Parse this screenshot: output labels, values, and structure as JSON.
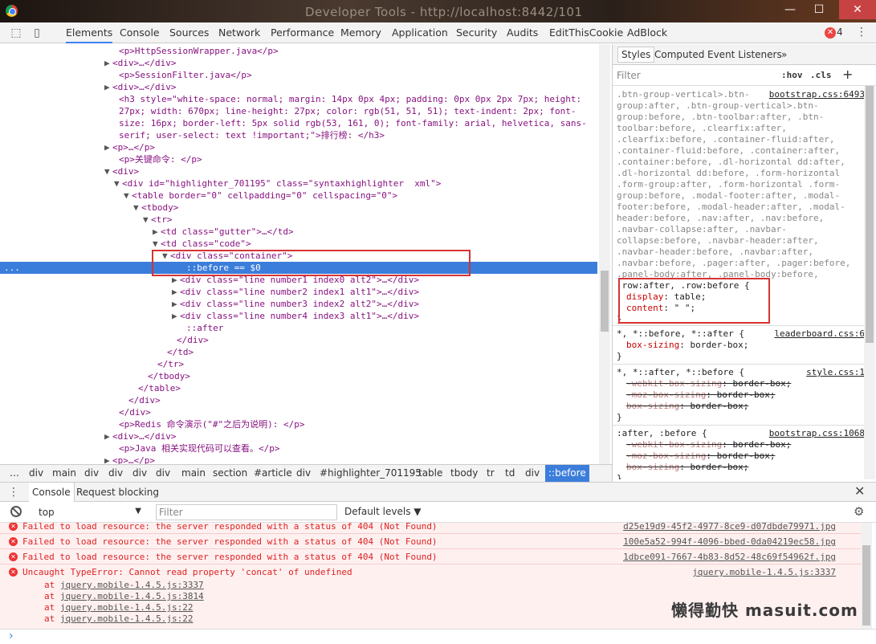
{
  "window": {
    "title": "Developer Tools - http://localhost:8442/101",
    "buttons": [
      "—",
      "☐",
      "✕"
    ]
  },
  "toolbar": {
    "tabs": [
      "Elements",
      "Console",
      "Sources",
      "Network",
      "Performance",
      "Memory",
      "Application",
      "Security",
      "Audits",
      "EditThisCookie",
      "AdBlock"
    ],
    "selected_tab": "Elements",
    "error_count": "4"
  },
  "dom_lines": [
    {
      "indent": 148,
      "tri": "",
      "html": "<p>HttpSessionWrapper.java</p>"
    },
    {
      "indent": 140,
      "tri": "▶",
      "html": "<div>…</div>"
    },
    {
      "indent": 148,
      "tri": "",
      "html": "<p>SessionFilter.java</p>"
    },
    {
      "indent": 140,
      "tri": "▶",
      "html": "<div>…</div>"
    },
    {
      "indent": 148,
      "tri": "",
      "html": "<h3 style=\"white-space: normal; margin: 14px 0px 4px; padding: 0px 0px 2px 7px; height:"
    },
    {
      "indent": 148,
      "tri": "",
      "html": "27px; width: 670px; line-height: 27px; color: rgb(51, 51, 51); text-indent: 2px; font-"
    },
    {
      "indent": 148,
      "tri": "",
      "html": "size: 16px; border-left: 5px solid rgb(53, 161, 0); font-family: arial, helvetica, sans-"
    },
    {
      "indent": 148,
      "tri": "",
      "html": "serif; user-select: text !important;\">排行榜: </h3>"
    },
    {
      "indent": 140,
      "tri": "▶",
      "html": "<p>…</p>"
    },
    {
      "indent": 148,
      "tri": "",
      "html": "<p>关键命令: </p>"
    },
    {
      "indent": 140,
      "tri": "▼",
      "html": "<div>"
    },
    {
      "indent": 152,
      "tri": "▼",
      "html": "<div id=\"highlighter_701195\" class=\"syntaxhighlighter  xml\">"
    },
    {
      "indent": 164,
      "tri": "▼",
      "html": "<table border=\"0\" cellpadding=\"0\" cellspacing=\"0\">"
    },
    {
      "indent": 176,
      "tri": "▼",
      "html": "<tbody>"
    },
    {
      "indent": 188,
      "tri": "▼",
      "html": "<tr>"
    },
    {
      "indent": 200,
      "tri": "▶",
      "html": "<td class=\"gutter\">…</td>"
    },
    {
      "indent": 200,
      "tri": "▼",
      "html": "<td class=\"code\">"
    },
    {
      "indent": 212,
      "tri": "▼",
      "html": "<div class=\"container\">"
    },
    {
      "indent": 232,
      "tri": "",
      "html": "::before == $0",
      "selected": true
    },
    {
      "indent": 224,
      "tri": "▶",
      "html": "<div class=\"line number1 index0 alt2\">…</div>"
    },
    {
      "indent": 224,
      "tri": "▶",
      "html": "<div class=\"line number2 index1 alt1\">…</div>"
    },
    {
      "indent": 224,
      "tri": "▶",
      "html": "<div class=\"line number3 index2 alt2\">…</div>"
    },
    {
      "indent": 224,
      "tri": "▶",
      "html": "<div class=\"line number4 index3 alt1\">…</div>"
    },
    {
      "indent": 232,
      "tri": "",
      "html": "::after"
    },
    {
      "indent": 220,
      "tri": "",
      "html": "</div>"
    },
    {
      "indent": 208,
      "tri": "",
      "html": "</td>"
    },
    {
      "indent": 196,
      "tri": "",
      "html": "</tr>"
    },
    {
      "indent": 184,
      "tri": "",
      "html": "</tbody>"
    },
    {
      "indent": 172,
      "tri": "",
      "html": "</table>"
    },
    {
      "indent": 160,
      "tri": "",
      "html": "</div>"
    },
    {
      "indent": 148,
      "tri": "",
      "html": "</div>"
    },
    {
      "indent": 148,
      "tri": "",
      "html": "<p>Redis 命令演示(\"#\"之后为说明): </p>"
    },
    {
      "indent": 140,
      "tri": "▶",
      "html": "<div>…</div>"
    },
    {
      "indent": 148,
      "tri": "",
      "html": "<p>Java 相关实现代码可以查看。</p>"
    },
    {
      "indent": 140,
      "tri": "▶",
      "html": "<p>…</p>"
    }
  ],
  "breadcrumbs": [
    "…",
    "div",
    "main",
    "div",
    "div",
    "div",
    "div",
    "main",
    "section",
    "#article",
    "div",
    "#highlighter_701195",
    "table",
    "tbody",
    "tr",
    "td",
    "div",
    "::before"
  ],
  "styles": {
    "tabs": [
      "Styles",
      "Computed",
      "Event Listeners",
      "»"
    ],
    "filter_placeholder": "Filter",
    "hov": ":hov",
    "cls": ".cls",
    "plus": "+",
    "selector_block": [
      ".btn-group-vertical>.btn-",
      "group:after, .btn-group-vertical>.btn-",
      "group:before, .btn-toolbar:after, .btn-",
      "toolbar:before, .clearfix:after,",
      ".clearfix:before, .container-fluid:after,",
      ".container-fluid:before, .container:after,",
      ".container:before, .dl-horizontal dd:after,",
      ".dl-horizontal dd:before, .form-horizontal",
      ".form-group:after, .form-horizontal .form-",
      "group:before, .modal-footer:after, .modal-",
      "footer:before, .modal-header:after, .modal-",
      "header:before, .nav:after, .nav:before,",
      ".navbar-collapse:after, .navbar-",
      "collapse:before, .navbar-header:after,",
      ".navbar-header:before, .navbar:after,",
      ".navbar:before, .pager:after, .pager:before,",
      ".panel-body:after, .panel-body:before,",
      ".row:after, .row:before {"
    ],
    "rule1_source": "bootstrap.css:6493",
    "rule1_decls": [
      {
        "prop": "display",
        "val": "table;"
      },
      {
        "prop": "content",
        "val": "\" \";"
      }
    ],
    "rule2_selector": "*, *::before, *::after {",
    "rule2_source": "leaderboard.css:6",
    "rule2_decl": {
      "prop": "box-sizing",
      "val": "border-box;"
    },
    "rule3_selector": "*, *::after, *::before {",
    "rule3_source": "style.css:1",
    "rule3_decls": [
      {
        "prop": "-webkit-box-sizing",
        "val": "border-box;"
      },
      {
        "prop": "-moz-box-sizing",
        "val": "border-box;"
      },
      {
        "prop": "box-sizing",
        "val": "border-box;"
      }
    ],
    "rule4_selector": ":after, :before {",
    "rule4_source": "bootstrap.css:1068",
    "rule4_decls": [
      {
        "prop": "-webkit-box-sizing",
        "val": "border-box;"
      },
      {
        "prop": "-moz-box-sizing",
        "val": "border-box;"
      },
      {
        "prop": "box-sizing",
        "val": "border-box;"
      }
    ],
    "close_brace": "}"
  },
  "drawer": {
    "tabs": [
      "Console",
      "Request blocking"
    ],
    "context": "top",
    "filter_placeholder": "Filter",
    "levels": "Default levels ▼"
  },
  "console": {
    "messages": [
      {
        "text": "Failed to load resource: the server responded with a status of 404 (Not Found)",
        "source": "d25e19d9-45f2-4977-8ce9-d07dbde79971.jpg"
      },
      {
        "text": "Failed to load resource: the server responded with a status of 404 (Not Found)",
        "source": "100e5a52-994f-4096-bbed-0da04219ec58.jpg"
      },
      {
        "text": "Failed to load resource: the server responded with a status of 404 (Not Found)",
        "source": "1dbce091-7667-4b83-8d52-48c69f54962f.jpg"
      },
      {
        "text": "Uncaught TypeError: Cannot read property 'concat' of undefined",
        "source": "jquery.mobile-1.4.5.js:3337"
      }
    ],
    "stack": [
      "jquery.mobile-1.4.5.js:3337",
      "jquery.mobile-1.4.5.js:3814",
      "jquery.mobile-1.4.5.js:22",
      "jquery.mobile-1.4.5.js:22"
    ],
    "stack_prefix": "at ",
    "prompt": "›"
  },
  "watermark": "懒得勤快 masuit.com",
  "colors": {
    "accent": "#3b7ddb",
    "error": "#d22222",
    "highlight_box": "#d63333"
  },
  "icons": [
    "inspect-icon",
    "device-toolbar-icon",
    "error-icon",
    "kebab-menu-icon",
    "clear-console-icon",
    "settings-gear-icon",
    "close-icon"
  ]
}
